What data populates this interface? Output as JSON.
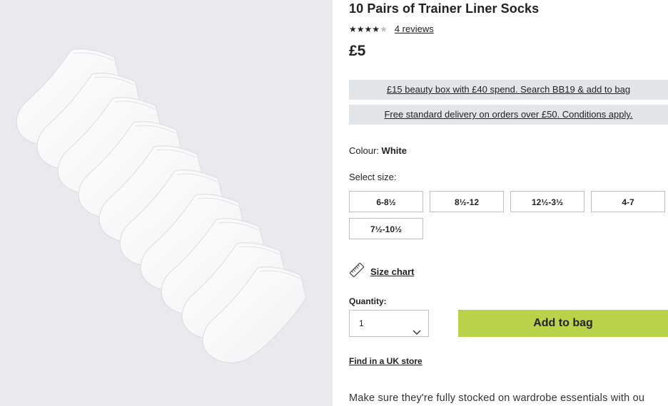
{
  "product": {
    "title": "10 Pairs of Trainer Liner Socks",
    "rating": 4,
    "rating_max": 5,
    "reviews_link": "4 reviews",
    "price": "£5",
    "image_alt": "socks-product-photo"
  },
  "promos": [
    "£15 beauty box with £40 spend. Search BB19 & add to bag",
    "Free standard delivery on orders over £50. Conditions apply."
  ],
  "colour": {
    "label": "Colour:",
    "value": "White"
  },
  "size": {
    "label": "Select size:",
    "options": [
      "6-8½",
      "8½-12",
      "12½-3½",
      "4-7",
      "7½-10½"
    ]
  },
  "size_chart": {
    "label": "Size chart",
    "icon": "ruler-icon"
  },
  "quantity": {
    "label": "Quantity:",
    "value": "1",
    "icon": "chevron-down-icon"
  },
  "actions": {
    "add_to_bag": "Add to bag",
    "find_store": "Find in a UK store"
  },
  "description": "Make sure they're fully stocked on wardrobe essentials with ou",
  "colors": {
    "add_button": "#b8d34a",
    "promo_bg": "#e3e6e9",
    "image_bg": "#eaeaee"
  }
}
